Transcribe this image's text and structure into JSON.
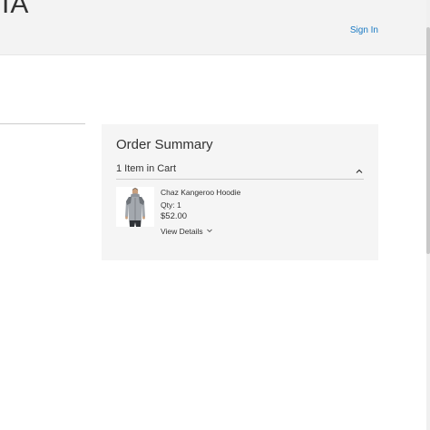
{
  "header": {
    "logo_text": "IA",
    "sign_in_label": "Sign In"
  },
  "order_summary": {
    "title": "Order Summary",
    "cart_count_label": "1 Item in Cart",
    "items": [
      {
        "name": "Chaz Kangeroo Hoodie",
        "qty_label": "Qty:",
        "qty": "1",
        "price": "$52.00",
        "view_details_label": "View Details"
      }
    ]
  },
  "colors": {
    "link": "#1979c3",
    "panel_bg": "#f5f5f5",
    "header_bg": "#f3f3f3",
    "text": "#333333"
  },
  "icons": {
    "cart_toggle": "chevron-up-icon",
    "view_details": "chevron-down-icon",
    "product_image": "hoodie-product-image"
  }
}
